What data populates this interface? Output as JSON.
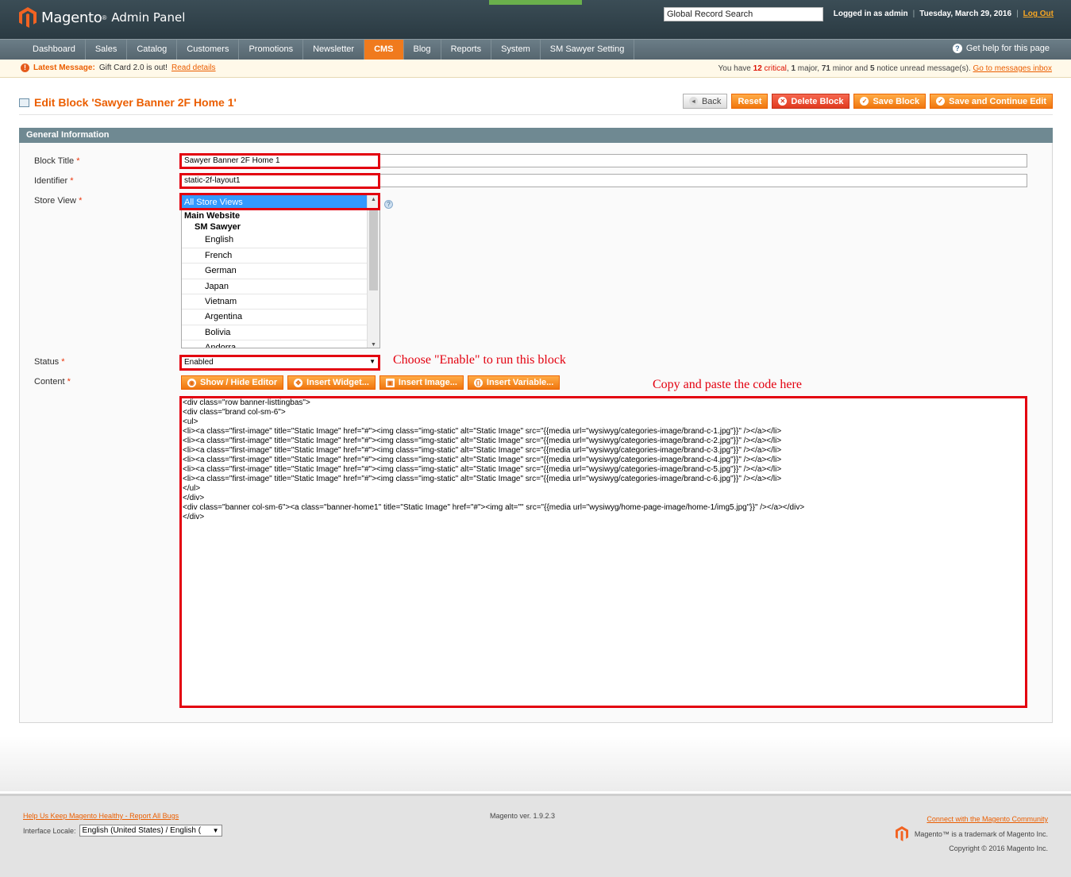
{
  "header": {
    "brand": "Magento",
    "brand_sub": "Admin Panel",
    "search_value": "Global Record Search",
    "logged_in": "Logged in as admin",
    "date": "Tuesday, March 29, 2016",
    "logout": "Log Out"
  },
  "nav": {
    "items": [
      "Dashboard",
      "Sales",
      "Catalog",
      "Customers",
      "Promotions",
      "Newsletter",
      "CMS",
      "Blog",
      "Reports",
      "System",
      "SM Sawyer Setting"
    ],
    "active": "CMS",
    "help": "Get help for this page"
  },
  "message_bar": {
    "label": "Latest Message:",
    "text": "Gift Card 2.0 is out!",
    "link": "Read details",
    "summary_prefix": "You have",
    "critical_count": "12",
    "critical_label": "critical",
    "major_count": "1",
    "major_label": "major",
    "minor_count": "71",
    "minor_label": "minor and",
    "notice_count": "5",
    "notice_label": "notice unread message(s).",
    "inbox_link": "Go to messages inbox"
  },
  "page": {
    "title": "Edit Block 'Sawyer Banner 2F Home 1'",
    "buttons": {
      "back": "Back",
      "reset": "Reset",
      "delete": "Delete Block",
      "save": "Save Block",
      "save_continue": "Save and Continue Edit"
    }
  },
  "form": {
    "section_title": "General Information",
    "block_title_label": "Block Title",
    "block_title_value": "Sawyer Banner 2F Home 1",
    "identifier_label": "Identifier",
    "identifier_value": "static-2f-layout1",
    "store_view_label": "Store View",
    "store_views": [
      {
        "label": "All Store Views",
        "level": 0,
        "selected": true,
        "bold": false
      },
      {
        "label": "Main Website",
        "level": 0,
        "selected": false,
        "bold": true
      },
      {
        "label": "SM Sawyer",
        "level": 1,
        "selected": false,
        "bold": true
      },
      {
        "label": "English",
        "level": 2,
        "selected": false,
        "bold": false
      },
      {
        "label": "French",
        "level": 2,
        "selected": false,
        "bold": false
      },
      {
        "label": "German",
        "level": 2,
        "selected": false,
        "bold": false
      },
      {
        "label": "Japan",
        "level": 2,
        "selected": false,
        "bold": false
      },
      {
        "label": "Vietnam",
        "level": 2,
        "selected": false,
        "bold": false
      },
      {
        "label": "Argentina",
        "level": 2,
        "selected": false,
        "bold": false
      },
      {
        "label": "Bolivia",
        "level": 2,
        "selected": false,
        "bold": false
      },
      {
        "label": "Andorra",
        "level": 2,
        "selected": false,
        "bold": false
      }
    ],
    "status_label": "Status",
    "status_value": "Enabled",
    "status_note": "Choose \"Enable\" to run this block",
    "content_label": "Content",
    "content_note": "Copy and paste the code here",
    "editor_buttons": {
      "show_hide": "Show / Hide Editor",
      "widget": "Insert Widget...",
      "image": "Insert Image...",
      "variable": "Insert Variable..."
    },
    "content_value": "<div class=\"row banner-listtingbas\">\n<div class=\"brand col-sm-6\">\n<ul>\n<li><a class=\"first-image\" title=\"Static Image\" href=\"#\"><img class=\"img-static\" alt=\"Static Image\" src=\"{{media url=\"wysiwyg/categories-image/brand-c-1.jpg\"}}\" /></a></li>\n<li><a class=\"first-image\" title=\"Static Image\" href=\"#\"><img class=\"img-static\" alt=\"Static Image\" src=\"{{media url=\"wysiwyg/categories-image/brand-c-2.jpg\"}}\" /></a></li>\n<li><a class=\"first-image\" title=\"Static Image\" href=\"#\"><img class=\"img-static\" alt=\"Static Image\" src=\"{{media url=\"wysiwyg/categories-image/brand-c-3.jpg\"}}\" /></a></li>\n<li><a class=\"first-image\" title=\"Static Image\" href=\"#\"><img class=\"img-static\" alt=\"Static Image\" src=\"{{media url=\"wysiwyg/categories-image/brand-c-4.jpg\"}}\" /></a></li>\n<li><a class=\"first-image\" title=\"Static Image\" href=\"#\"><img class=\"img-static\" alt=\"Static Image\" src=\"{{media url=\"wysiwyg/categories-image/brand-c-5.jpg\"}}\" /></a></li>\n<li><a class=\"first-image\" title=\"Static Image\" href=\"#\"><img class=\"img-static\" alt=\"Static Image\" src=\"{{media url=\"wysiwyg/categories-image/brand-c-6.jpg\"}}\" /></a></li>\n</ul>\n</div>\n<div class=\"banner col-sm-6\"><a class=\"banner-home1\" title=\"Static Image\" href=\"#\"><img alt=\"\" src=\"{{media url=\"wysiwyg/home-page-image/home-1/img5.jpg\"}}\" /></a></div>\n</div>"
  },
  "footer": {
    "bugs_link": "Help Us Keep Magento Healthy - Report All Bugs",
    "locale_label": "Interface Locale:",
    "locale_value": "English (United States) / English (",
    "version": "Magento ver. 1.9.2.3",
    "community_link": "Connect with the Magento Community",
    "trademark": "Magento™ is a trademark of Magento Inc.",
    "copyright": "Copyright © 2016 Magento Inc."
  },
  "colors": {
    "accent": "#eb5e00",
    "highlight_red": "#e3000f",
    "header_dark": "#2a3a42",
    "section_head": "#6f8992"
  }
}
